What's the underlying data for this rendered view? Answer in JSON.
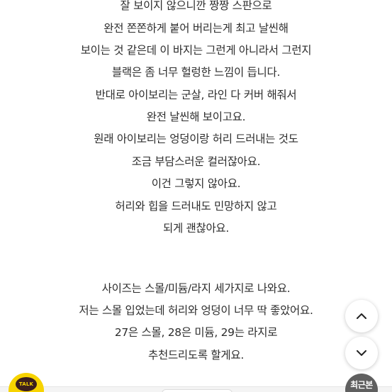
{
  "review": {
    "paragraph1": [
      "잘 보이지 않으니깐 짱짱 스판으로",
      "완전 쫀쫀하게 붙어 버리는게 최고 날씬해",
      "보이는 것 같은데 이 바지는 그런게 아니라서 그런지",
      "블랙은 좀 너무 헐렁한 느낌이 듭니다.",
      "반대로 아이보리는 군살, 라인 다 커버 해줘서",
      "완전 날씬해 보이고요.",
      "원래 아이보리는 엉덩이랑 허리 드러내는 것도",
      "조금 부담스러운 컬러잖아요.",
      "이건 그렇지 않아요.",
      "허리와 힙을 드러내도 민망하지 않고",
      "되게 괜찮아요."
    ],
    "paragraph2": [
      "사이즈는 스몰/미듐/라지 세가지로 나와요.",
      "저는 스몰 입었는데 허리와 엉덩이 너무 딱 좋았어요.",
      "27은 스몰, 28은 미듐, 29는 라지로",
      "추천드리도록 할게요."
    ]
  },
  "floating": {
    "scroll_up_icon": "chevron-up-icon",
    "scroll_down_icon": "chevron-down-icon",
    "kakao_label": "TALK",
    "recent_label": "최근본"
  },
  "colors": {
    "text": "#2d2d2d",
    "kakao_yellow": "#f7d300",
    "kakao_brown": "#3b1e1e",
    "recent_bg": "#5f5f5f"
  }
}
